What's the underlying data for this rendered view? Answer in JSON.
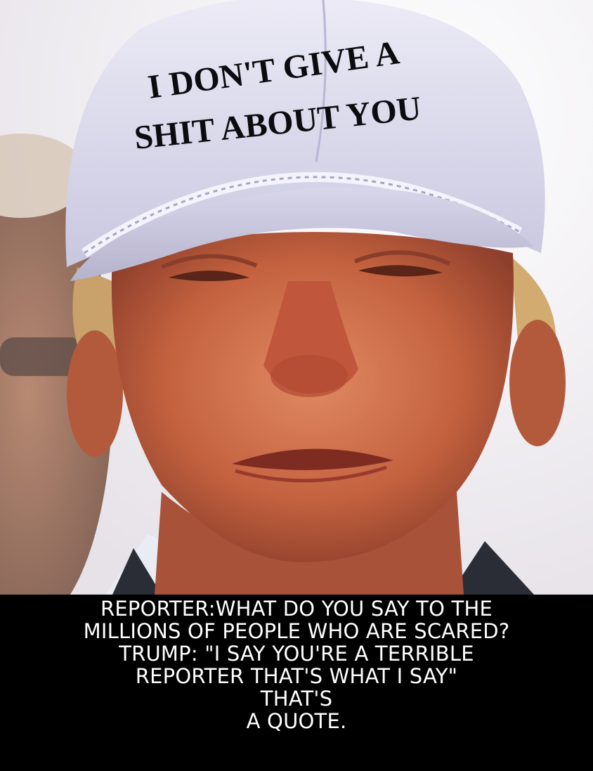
{
  "hat": {
    "line1": "I DON'T GIVE A",
    "line2": "SHIT ABOUT YOU"
  },
  "caption": {
    "lines": [
      "REPORTER:WHAT DO YOU SAY TO THE",
      "MILLIONS OF PEOPLE WHO ARE SCARED?",
      "TRUMP: \"I SAY YOU'RE A TERRIBLE",
      "REPORTER THAT'S WHAT I SAY\"",
      "THAT'S",
      "A QUOTE."
    ]
  },
  "colors": {
    "caption_background": "#000000",
    "caption_text": "#ffffff",
    "hat": "#d9d8ec",
    "skin": "#c96a4e",
    "background": "#f2f0f3"
  }
}
